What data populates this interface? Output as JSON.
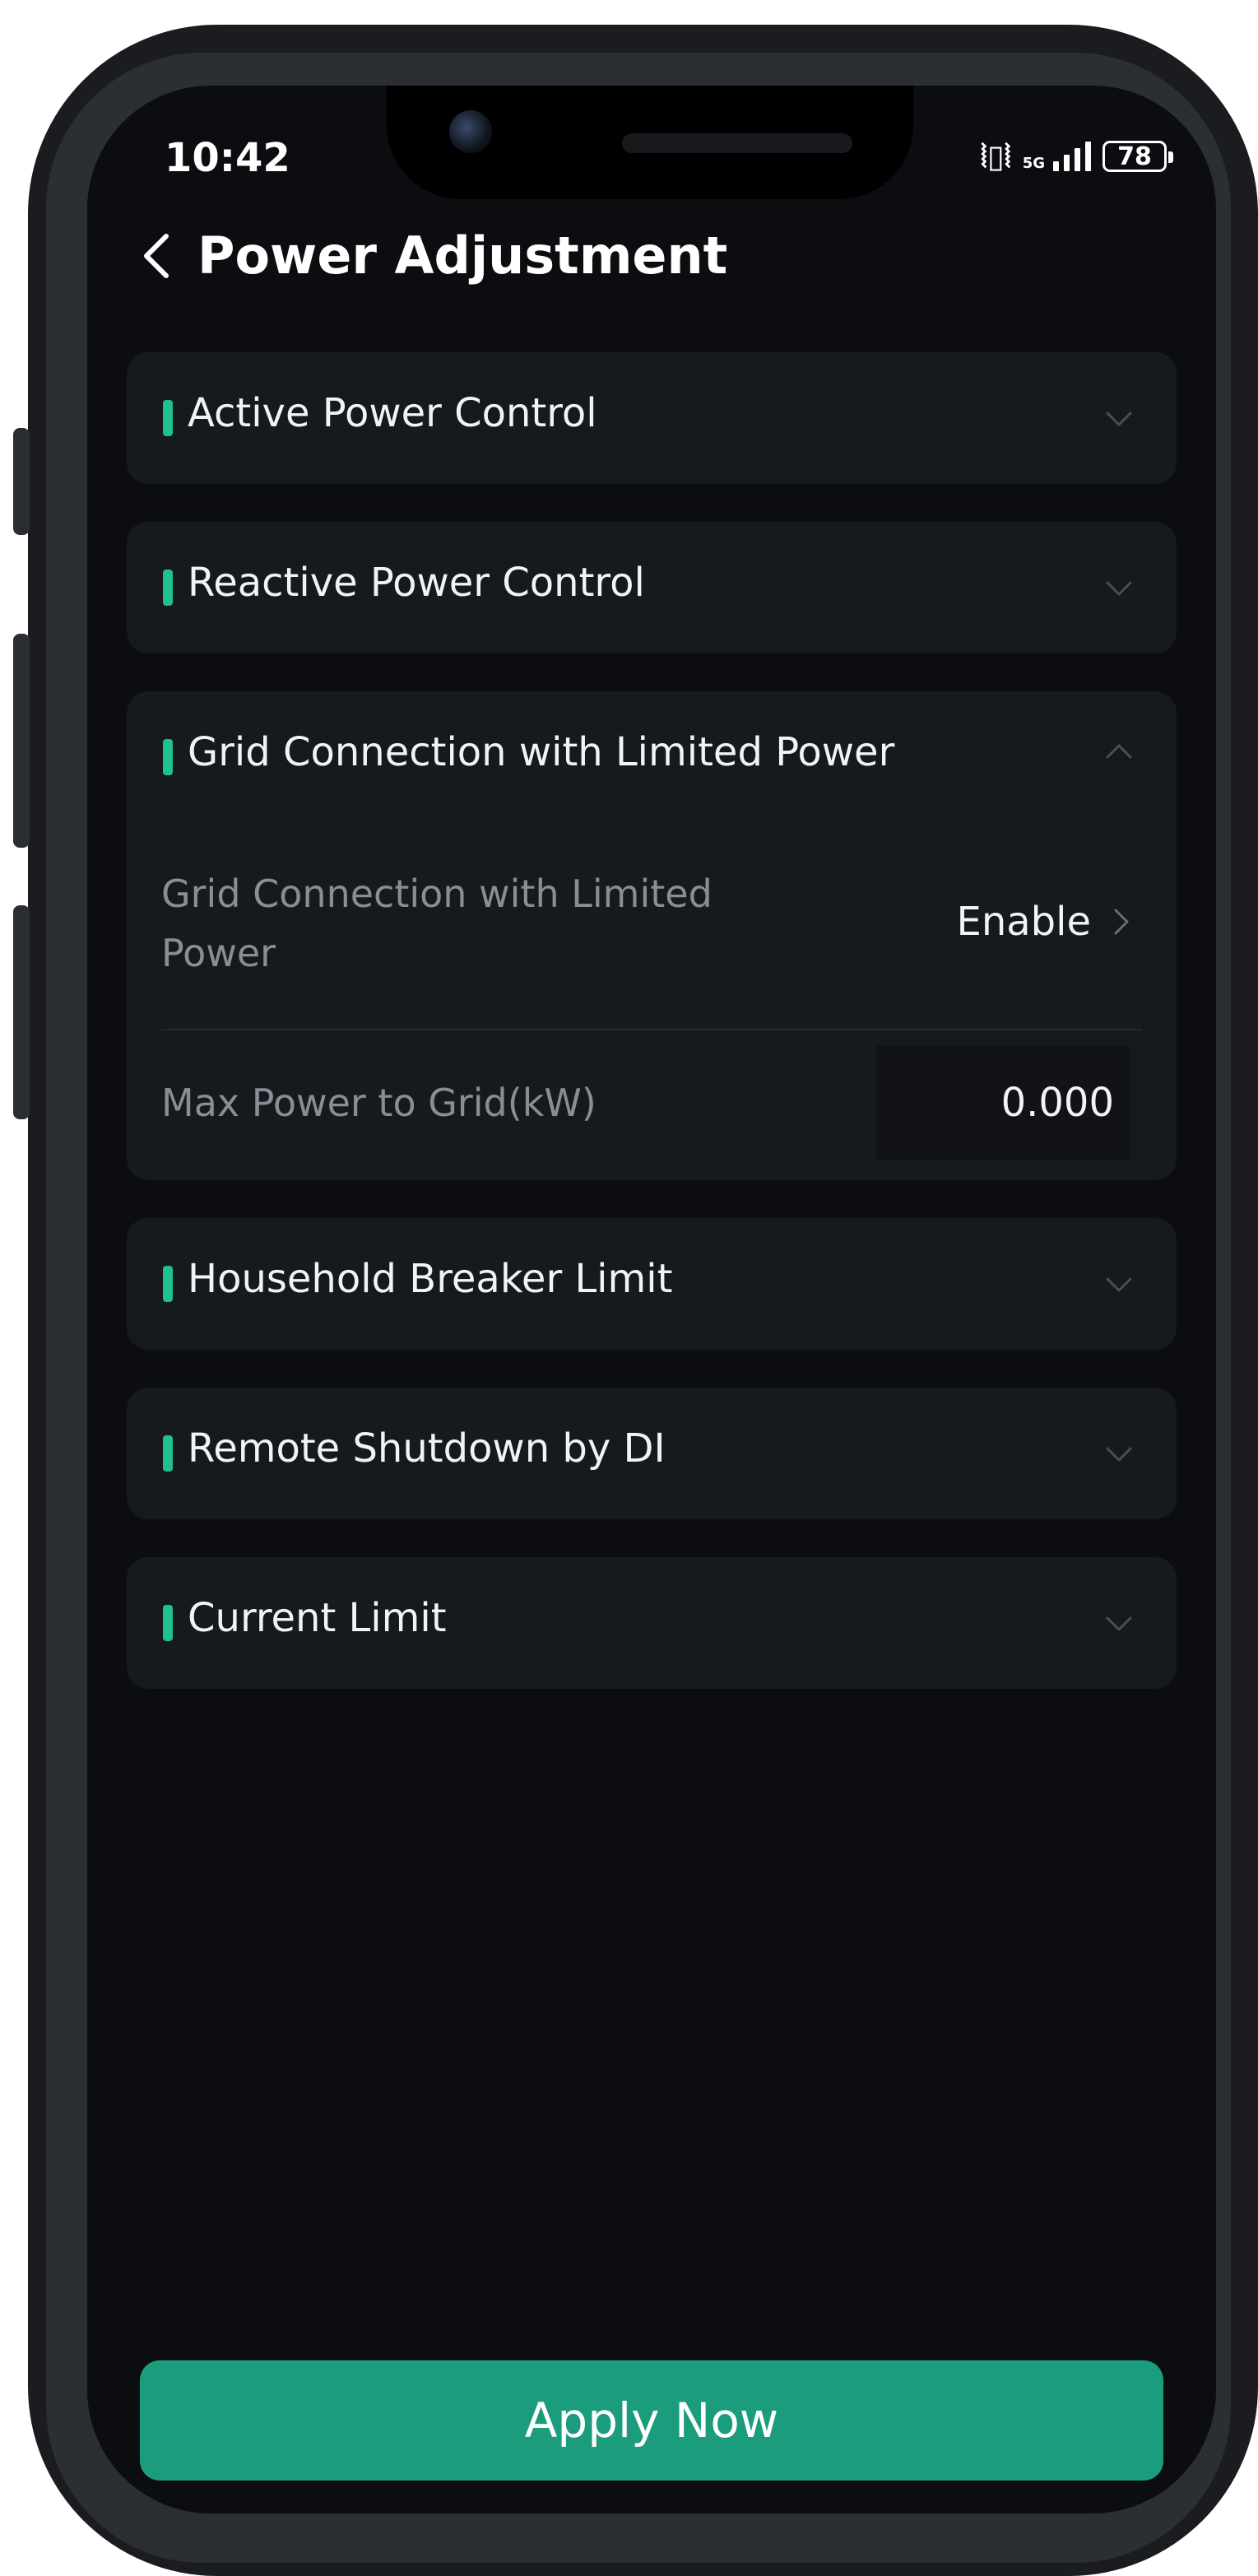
{
  "status_bar": {
    "time": "10:42",
    "network": "5G",
    "battery": "78"
  },
  "header": {
    "title": "Power Adjustment"
  },
  "sections": [
    {
      "title": "Active Power Control",
      "expanded": false
    },
    {
      "title": "Reactive Power Control",
      "expanded": false
    },
    {
      "title": "Grid Connection with Limited Power",
      "expanded": true,
      "rows": [
        {
          "label": "Grid Connection with Limited Power",
          "value": "Enable"
        },
        {
          "label": "Max Power to Grid(kW)",
          "value": "0.000"
        }
      ]
    },
    {
      "title": "Household Breaker Limit",
      "expanded": false
    },
    {
      "title": "Remote Shutdown by DI",
      "expanded": false
    },
    {
      "title": "Current Limit",
      "expanded": false
    }
  ],
  "footer": {
    "apply_label": "Apply Now"
  },
  "colors": {
    "accent": "#1fbf8f",
    "button": "#1b9c7c",
    "background": "#0c0d10",
    "card": "#16191d"
  }
}
